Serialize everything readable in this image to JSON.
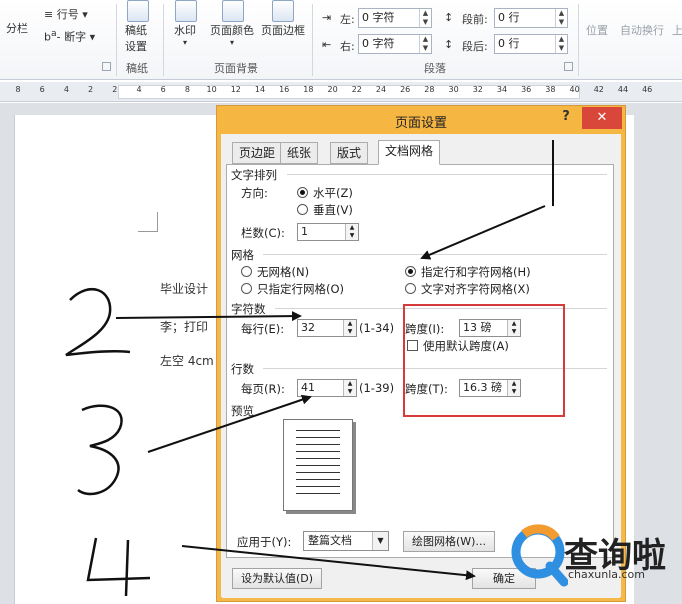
{
  "ribbon": {
    "btn_columns": "分栏",
    "btn_line_numbers": "行号",
    "btn_hyphenation": "断字",
    "btn_manuscript_settings": [
      "稿纸",
      "设置"
    ],
    "grp_manuscript": "稿纸",
    "btn_watermark": "水印",
    "btn_page_color": "页面颜色",
    "btn_page_borders": "页面边框",
    "grp_page_background": "页面背景",
    "indent_left_label": "左:",
    "indent_left_value": "0 字符",
    "indent_right_label": "右:",
    "indent_right_value": "0 字符",
    "spacing_before_label": "段前:",
    "spacing_before_value": "0 行",
    "spacing_after_label": "段后:",
    "spacing_after_value": "0 行",
    "grp_paragraph": "段落",
    "btn_position": "位置",
    "btn_wrap_text": "自动换行",
    "btn_bring_forward": "上"
  },
  "ruler": {
    "ticks": [
      "8",
      "6",
      "4",
      "2",
      "2",
      "4",
      "6",
      "8",
      "10",
      "12",
      "14",
      "16",
      "18",
      "20",
      "22",
      "24",
      "26",
      "28",
      "30",
      "32",
      "34",
      "36",
      "38",
      "40",
      "42",
      "44",
      "46"
    ]
  },
  "document": {
    "line1": "毕业设计",
    "line2": "李；打印",
    "line3": "左空 4cm"
  },
  "dialog": {
    "title": "页面设置",
    "help": "?",
    "close": "✕",
    "tabs": [
      "页边距",
      "纸张",
      "版式",
      "文档网格"
    ],
    "text_direction_section": "文字排列",
    "direction_label": "方向:",
    "direction_horizontal": "水平(Z)",
    "direction_vertical": "垂直(V)",
    "columns_label": "栏数(C):",
    "columns_value": "1",
    "grid_section": "网格",
    "grid_none": "无网格(N)",
    "grid_lines_chars": "指定行和字符网格(H)",
    "grid_lines_only": "只指定行网格(O)",
    "grid_snap_chars": "文字对齐字符网格(X)",
    "chars_section": "字符数",
    "chars_per_line_label": "每行(E):",
    "chars_per_line_value": "32",
    "chars_range": "(1-34)",
    "chars_pitch_label": "跨度(I):",
    "chars_pitch_value": "13 磅",
    "use_default_pitch": "使用默认跨度(A)",
    "lines_section": "行数",
    "lines_per_page_label": "每页(R):",
    "lines_per_page_value": "41",
    "lines_range": "(1-39)",
    "lines_pitch_label": "跨度(T):",
    "lines_pitch_value": "16.3 磅",
    "preview_section": "预览",
    "apply_to_label": "应用于(Y):",
    "apply_to_value": "整篇文档",
    "drawing_grid_button": "绘图网格(W)...",
    "set_default_button": "设为默认值(D)",
    "ok_button": "确定"
  },
  "annotations": {
    "num2": "2",
    "num3": "3",
    "num4": "4",
    "box_color": "#d63a3a"
  },
  "watermark": {
    "brand": "查询啦",
    "url": "chaxunla.com"
  },
  "colors": {
    "title_bar": "#f6b642",
    "close_button": "#d9463a",
    "watermark_q_orange": "#f29b2e",
    "watermark_q_blue": "#2f8fe0"
  }
}
